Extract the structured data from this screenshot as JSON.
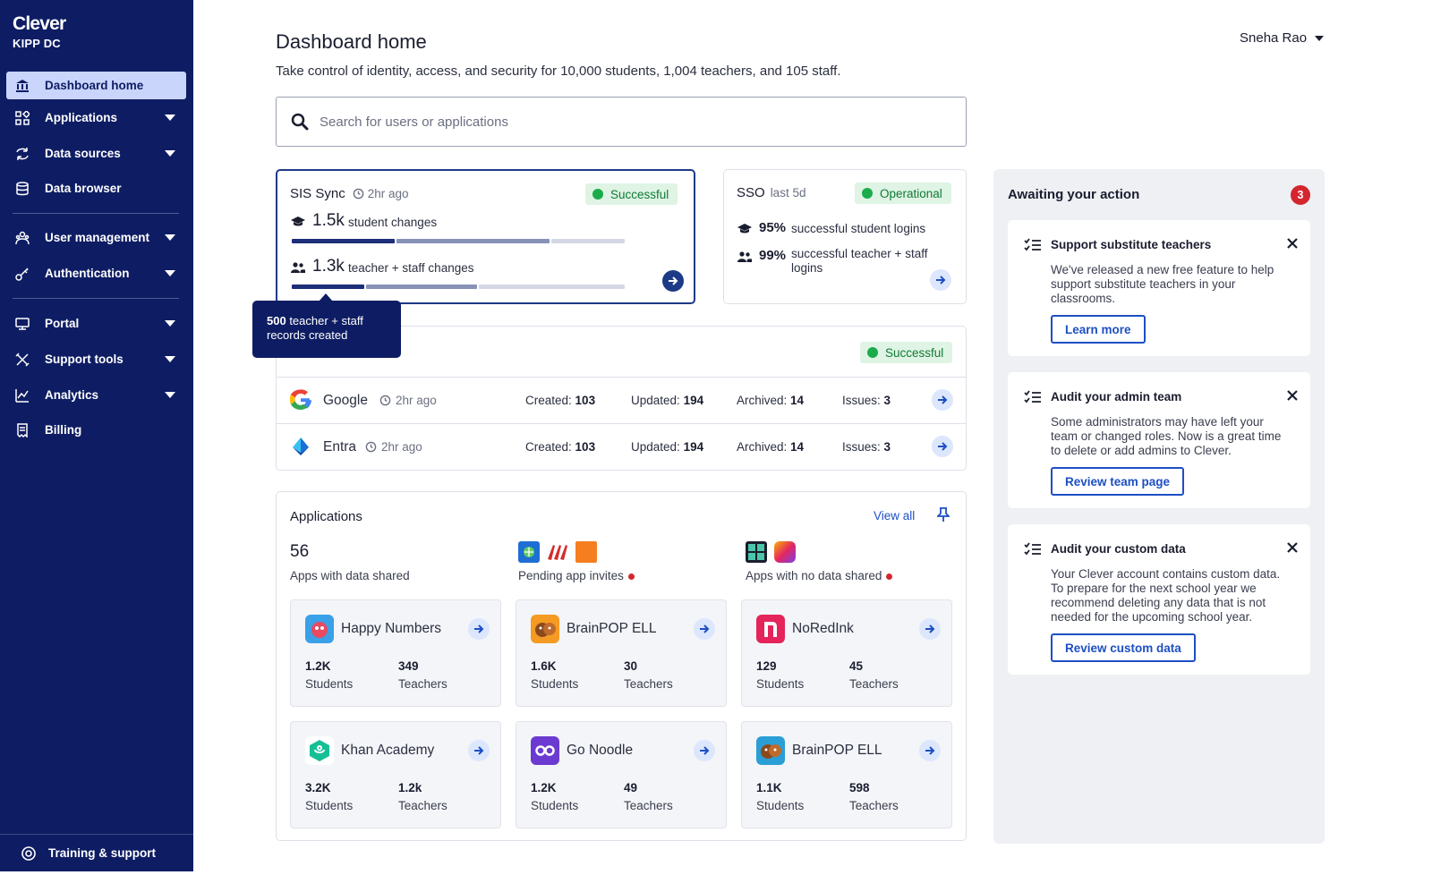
{
  "brand": {
    "logo": "Clever",
    "org": "KIPP DC"
  },
  "sidebar": {
    "items": [
      {
        "label": "Dashboard home",
        "icon": "bank-icon"
      },
      {
        "label": "Applications",
        "icon": "apps-grid-icon"
      },
      {
        "label": "Data sources",
        "icon": "sync-arrows-icon"
      },
      {
        "label": "Data browser",
        "icon": "database-icon"
      },
      {
        "label": "User management",
        "icon": "users-icon"
      },
      {
        "label": "Authentication",
        "icon": "key-icon"
      },
      {
        "label": "Portal",
        "icon": "monitor-icon"
      },
      {
        "label": "Support tools",
        "icon": "tools-icon"
      },
      {
        "label": "Analytics",
        "icon": "chart-icon"
      },
      {
        "label": "Billing",
        "icon": "receipt-icon"
      }
    ],
    "footer": "Training & support"
  },
  "header": {
    "title": "Dashboard home",
    "subtitle": "Take control of identity, access, and security for 10,000 students, 1,004 teachers, and 105 staff.",
    "user": "Sneha Rao"
  },
  "search": {
    "placeholder": "Search for users or applications"
  },
  "sis": {
    "title": "SIS Sync",
    "time": "2hr ago",
    "status": "Successful",
    "student_count": "1.5k",
    "student_label": "student changes",
    "staff_count": "1.3k",
    "staff_label": "teacher + staff changes"
  },
  "tooltip": {
    "count": "500",
    "text": " teacher + staff records created"
  },
  "sso": {
    "title": "SSO",
    "period": "last 5d",
    "status": "Operational",
    "student_pct": "95%",
    "student_label": "successful student logins",
    "teacher_pct": "99%",
    "teacher_label": "successful teacher + staff logins"
  },
  "sync": {
    "status": "Successful",
    "rows": [
      {
        "name": "Google",
        "time": "2hr ago",
        "created_label": "Created:",
        "created": "103",
        "updated_label": "Updated:",
        "updated": "194",
        "archived_label": "Archived:",
        "archived": "14",
        "issues_label": "Issues:",
        "issues": "3"
      },
      {
        "name": "Entra",
        "time": "2hr ago",
        "created_label": "Created:",
        "created": "103",
        "updated_label": "Updated:",
        "updated": "194",
        "archived_label": "Archived:",
        "archived": "14",
        "issues_label": "Issues:",
        "issues": "3"
      }
    ]
  },
  "apps": {
    "title": "Applications",
    "view_all": "View all",
    "shared_count": "56",
    "shared_label": "Apps with data shared",
    "pending_label": "Pending app invites",
    "nodata_label": "Apps with no data shared",
    "students_label": "Students",
    "teachers_label": "Teachers",
    "cards": [
      {
        "name": "Happy Numbers",
        "students": "1.2K",
        "teachers": "349",
        "color": "#3aa0e8",
        "icon": "happy-numbers-logo-icon"
      },
      {
        "name": "BrainPOP ELL",
        "students": "1.6K",
        "teachers": "30",
        "color": "#f59a23",
        "icon": "brainpop-logo-icon"
      },
      {
        "name": "NoRedInk",
        "students": "129",
        "teachers": "45",
        "color": "#e4245a",
        "icon": "noredink-logo-icon"
      },
      {
        "name": "Khan Academy",
        "students": "3.2K",
        "teachers": "1.2k",
        "color": "#14bf96",
        "icon": "khan-academy-logo-icon"
      },
      {
        "name": "Go Noodle",
        "students": "1.2K",
        "teachers": "49",
        "color": "#6a3ad1",
        "icon": "gonoodle-logo-icon"
      },
      {
        "name": "BrainPOP ELL",
        "students": "1.1K",
        "teachers": "598",
        "color": "#f59a23",
        "icon": "brainpop-logo-icon"
      }
    ]
  },
  "awaiting": {
    "title": "Awaiting your action",
    "count": "3",
    "items": [
      {
        "title": "Support substitute teachers",
        "body": "We've released a new free feature to help support substitute teachers in your classrooms.",
        "button": "Learn more"
      },
      {
        "title": "Audit your admin team",
        "body": "Some administrators may have left your team or changed roles. Now is a great time to delete or add admins to Clever.",
        "button": "Review team page"
      },
      {
        "title": "Audit your custom data",
        "body": "Your Clever account contains custom data. To prepare for the next school year we recommend deleting any data that is not needed for the upcoming school year.",
        "button": "Review custom data"
      }
    ]
  },
  "colors": {
    "navy": "#0e1d63",
    "accent": "#1d4fc4",
    "success": "#1aac4a",
    "danger": "#d3262f"
  }
}
